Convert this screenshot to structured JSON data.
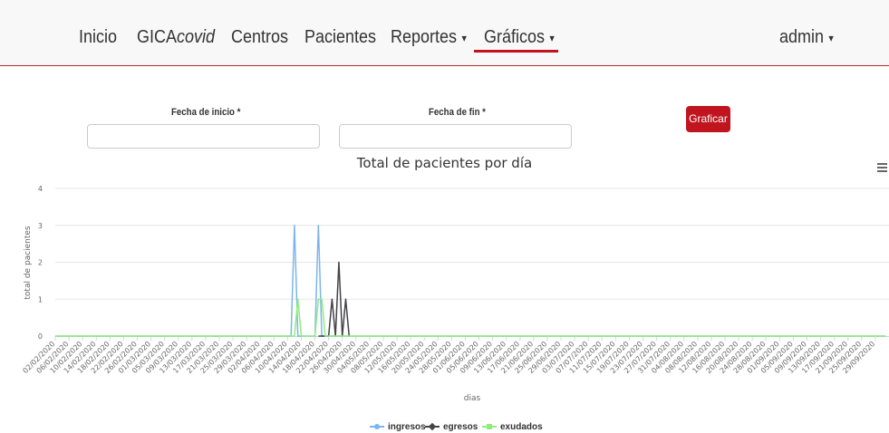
{
  "nav": {
    "inicio": "Inicio",
    "brand_prefix": "GICA",
    "brand_suffix": "covid",
    "centros": "Centros",
    "pacientes": "Pacientes",
    "reportes": "Reportes",
    "graficos": "Gráficos",
    "admin": "admin",
    "caret": "▾",
    "accent_color": "#c0141f"
  },
  "form": {
    "start_label": "Fecha de inicio *",
    "start_value": "",
    "end_label": "Fecha de fin *",
    "end_value": "",
    "submit_label": "Graficar"
  },
  "chart_menu_icon": "hamburger-menu-icon",
  "chart_data": {
    "type": "line",
    "title": "Total de pacientes por día",
    "xlabel": "dias",
    "ylabel": "total de pacientes",
    "ylim": [
      0,
      4
    ],
    "yticks": [
      0,
      1,
      2,
      3,
      4
    ],
    "grid": true,
    "legend_position": "bottom",
    "x": [
      "02/02/2020",
      "03/02/2020",
      "04/02/2020",
      "05/02/2020",
      "06/02/2020",
      "07/02/2020",
      "08/02/2020",
      "09/02/2020",
      "10/02/2020",
      "11/02/2020",
      "12/02/2020",
      "13/02/2020",
      "14/02/2020",
      "15/02/2020",
      "16/02/2020",
      "17/02/2020",
      "18/02/2020",
      "19/02/2020",
      "20/02/2020",
      "21/02/2020",
      "22/02/2020",
      "23/02/2020",
      "24/02/2020",
      "25/02/2020",
      "26/02/2020",
      "27/02/2020",
      "28/02/2020",
      "29/02/2020",
      "01/03/2020",
      "02/03/2020",
      "03/03/2020",
      "04/03/2020",
      "05/03/2020",
      "06/03/2020",
      "07/03/2020",
      "08/03/2020",
      "09/03/2020",
      "10/03/2020",
      "11/03/2020",
      "12/03/2020",
      "13/03/2020",
      "14/03/2020",
      "15/03/2020",
      "16/03/2020",
      "17/03/2020",
      "18/03/2020",
      "19/03/2020",
      "20/03/2020",
      "21/03/2020",
      "22/03/2020",
      "23/03/2020",
      "24/03/2020",
      "25/03/2020",
      "26/03/2020",
      "27/03/2020",
      "28/03/2020",
      "29/03/2020",
      "30/03/2020",
      "31/03/2020",
      "01/04/2020",
      "02/04/2020",
      "03/04/2020",
      "04/04/2020",
      "05/04/2020",
      "06/04/2020",
      "07/04/2020",
      "08/04/2020",
      "09/04/2020",
      "10/04/2020",
      "11/04/2020",
      "12/04/2020",
      "13/04/2020",
      "14/04/2020",
      "15/04/2020",
      "16/04/2020",
      "17/04/2020",
      "18/04/2020",
      "19/04/2020",
      "20/04/2020",
      "21/04/2020",
      "22/04/2020",
      "23/04/2020",
      "24/04/2020",
      "25/04/2020",
      "26/04/2020",
      "27/04/2020",
      "28/04/2020",
      "29/04/2020",
      "30/04/2020",
      "01/05/2020",
      "02/05/2020",
      "03/05/2020",
      "04/05/2020",
      "05/05/2020",
      "06/05/2020",
      "07/05/2020",
      "08/05/2020",
      "09/05/2020",
      "10/05/2020",
      "11/05/2020",
      "12/05/2020",
      "13/05/2020",
      "14/05/2020",
      "15/05/2020",
      "16/05/2020",
      "17/05/2020",
      "18/05/2020",
      "19/05/2020",
      "20/05/2020",
      "21/05/2020",
      "22/05/2020",
      "23/05/2020",
      "24/05/2020",
      "25/05/2020",
      "26/05/2020",
      "27/05/2020",
      "28/05/2020",
      "29/05/2020",
      "30/05/2020",
      "31/05/2020",
      "01/06/2020",
      "02/06/2020",
      "03/06/2020",
      "04/06/2020",
      "05/06/2020",
      "06/06/2020",
      "07/06/2020",
      "08/06/2020",
      "09/06/2020",
      "10/06/2020",
      "11/06/2020",
      "12/06/2020",
      "13/06/2020",
      "14/06/2020",
      "15/06/2020",
      "16/06/2020",
      "17/06/2020",
      "18/06/2020",
      "19/06/2020",
      "20/06/2020",
      "21/06/2020",
      "22/06/2020",
      "23/06/2020",
      "24/06/2020",
      "25/06/2020",
      "26/06/2020",
      "27/06/2020",
      "28/06/2020",
      "29/06/2020",
      "30/06/2020",
      "01/07/2020",
      "02/07/2020",
      "03/07/2020",
      "04/07/2020",
      "05/07/2020",
      "06/07/2020",
      "07/07/2020",
      "08/07/2020",
      "09/07/2020",
      "10/07/2020",
      "11/07/2020",
      "12/07/2020",
      "13/07/2020",
      "14/07/2020",
      "15/07/2020",
      "16/07/2020",
      "17/07/2020",
      "18/07/2020",
      "19/07/2020",
      "20/07/2020",
      "21/07/2020",
      "22/07/2020",
      "23/07/2020",
      "24/07/2020",
      "25/07/2020",
      "26/07/2020",
      "27/07/2020",
      "28/07/2020",
      "29/07/2020",
      "30/07/2020",
      "31/07/2020",
      "01/08/2020",
      "02/08/2020",
      "03/08/2020",
      "04/08/2020",
      "05/08/2020",
      "06/08/2020",
      "07/08/2020",
      "08/08/2020",
      "09/08/2020",
      "10/08/2020",
      "11/08/2020",
      "12/08/2020",
      "13/08/2020",
      "14/08/2020",
      "15/08/2020",
      "16/08/2020",
      "17/08/2020",
      "18/08/2020",
      "19/08/2020",
      "20/08/2020",
      "21/08/2020",
      "22/08/2020",
      "23/08/2020",
      "24/08/2020",
      "25/08/2020",
      "26/08/2020",
      "27/08/2020",
      "28/08/2020",
      "29/08/2020",
      "30/08/2020",
      "31/08/2020",
      "01/09/2020",
      "02/09/2020",
      "03/09/2020",
      "04/09/2020",
      "05/09/2020",
      "06/09/2020",
      "07/09/2020",
      "08/09/2020",
      "09/09/2020",
      "10/09/2020",
      "11/09/2020",
      "12/09/2020",
      "13/09/2020",
      "14/09/2020",
      "15/09/2020",
      "16/09/2020",
      "17/09/2020",
      "18/09/2020",
      "19/09/2020",
      "20/09/2020",
      "21/09/2020",
      "22/09/2020",
      "23/09/2020",
      "24/09/2020",
      "25/09/2020",
      "26/09/2020",
      "27/09/2020",
      "28/09/2020",
      "29/09/2020",
      "30/09/2020",
      "01/10/2020",
      "02/10/2020",
      "03/10/2020"
    ],
    "xtick_labels": [
      "02/02/2020",
      "06/02/2020",
      "10/02/2020",
      "14/02/2020",
      "18/02/2020",
      "22/02/2020",
      "26/02/2020",
      "01/03/2020",
      "05/03/2020",
      "09/03/2020",
      "13/03/2020",
      "17/03/2020",
      "21/03/2020",
      "25/03/2020",
      "29/03/2020",
      "02/04/2020",
      "06/04/2020",
      "10/04/2020",
      "14/04/2020",
      "18/04/2020",
      "22/04/2020",
      "26/04/2020",
      "30/04/2020",
      "04/05/2020",
      "08/05/2020",
      "12/05/2020",
      "16/05/2020",
      "20/05/2020",
      "24/05/2020",
      "28/05/2020",
      "01/06/2020",
      "05/06/2020",
      "09/06/2020",
      "13/06/2020",
      "17/06/2020",
      "21/06/2020",
      "25/06/2020",
      "29/06/2020",
      "03/07/2020",
      "07/07/2020",
      "11/07/2020",
      "15/07/2020",
      "19/07/2020",
      "23/07/2020",
      "27/07/2020",
      "31/07/2020",
      "04/08/2020",
      "08/08/2020",
      "12/08/2020",
      "16/08/2020",
      "20/08/2020",
      "24/08/2020",
      "28/08/2020",
      "01/09/2020",
      "05/09/2020",
      "09/09/2020",
      "13/09/2020",
      "17/09/2020",
      "21/09/2020",
      "25/09/2020",
      "29/09/2020"
    ],
    "series": [
      {
        "name": "ingresos",
        "color": "#7cb5ec",
        "marker": "circle",
        "values": [
          0,
          0,
          0,
          0,
          0,
          0,
          0,
          0,
          0,
          0,
          0,
          0,
          0,
          0,
          0,
          0,
          0,
          0,
          0,
          0,
          0,
          0,
          0,
          0,
          0,
          0,
          0,
          0,
          0,
          0,
          0,
          0,
          0,
          0,
          0,
          0,
          0,
          0,
          0,
          0,
          0,
          0,
          0,
          0,
          0,
          0,
          0,
          0,
          0,
          0,
          0,
          0,
          0,
          0,
          0,
          0,
          0,
          0,
          0,
          0,
          0,
          0,
          0,
          0,
          0,
          0,
          0,
          0,
          0,
          0,
          3,
          0,
          0,
          0,
          0,
          0,
          0,
          3,
          0,
          0,
          0,
          0,
          0,
          0,
          0,
          0,
          0,
          0,
          0,
          0,
          0,
          0,
          0,
          0,
          0,
          0,
          0,
          0,
          0,
          0,
          0,
          0,
          0,
          0,
          0,
          0,
          0,
          0,
          0,
          0,
          0,
          0,
          0,
          0,
          0,
          0,
          0,
          0,
          0,
          0,
          0,
          0,
          0,
          0,
          0,
          0,
          0,
          0,
          0,
          0,
          0,
          0,
          0,
          0,
          0,
          0,
          0,
          0,
          0,
          0,
          0,
          0,
          0,
          0,
          0,
          0,
          0,
          0,
          0,
          0,
          0,
          0,
          0,
          0,
          0,
          0,
          0,
          0,
          0,
          0,
          0,
          0,
          0,
          0,
          0,
          0,
          0,
          0,
          0,
          0,
          0,
          0,
          0,
          0,
          0,
          0,
          0,
          0,
          0,
          0,
          0,
          0,
          0,
          0,
          0,
          0,
          0,
          0,
          0,
          0,
          0,
          0,
          0,
          0,
          0,
          0,
          0,
          0,
          0,
          0,
          0,
          0,
          0,
          0,
          0,
          0,
          0,
          0,
          0,
          0,
          0,
          0,
          0,
          0,
          0,
          0,
          0,
          0,
          0,
          0,
          0,
          0,
          0,
          0,
          0,
          0,
          0,
          0,
          0,
          0,
          0,
          0,
          0,
          0,
          0,
          0,
          0,
          0,
          0,
          0,
          0,
          0,
          0,
          0
        ]
      },
      {
        "name": "egresos",
        "color": "#434348",
        "marker": "diamond",
        "values": [
          null,
          null,
          null,
          null,
          null,
          null,
          null,
          null,
          null,
          null,
          null,
          null,
          null,
          null,
          null,
          null,
          null,
          null,
          null,
          null,
          null,
          null,
          null,
          null,
          null,
          null,
          null,
          null,
          null,
          null,
          null,
          null,
          null,
          null,
          null,
          null,
          null,
          null,
          null,
          null,
          null,
          null,
          null,
          null,
          null,
          null,
          null,
          null,
          null,
          null,
          null,
          null,
          null,
          null,
          null,
          null,
          null,
          null,
          null,
          null,
          null,
          null,
          null,
          null,
          null,
          null,
          null,
          null,
          null,
          null,
          null,
          null,
          null,
          null,
          null,
          null,
          null,
          0,
          0,
          0,
          0,
          1,
          0,
          2,
          0,
          1,
          0,
          null,
          null,
          null,
          null,
          null,
          null,
          null,
          null,
          null,
          null,
          null,
          null,
          null,
          null,
          null,
          null,
          null,
          null,
          null,
          null,
          null,
          null,
          null,
          null,
          null,
          null,
          null,
          null,
          null,
          null,
          null,
          null,
          null,
          null,
          null,
          null,
          null,
          null,
          null,
          null,
          null,
          null,
          null,
          null,
          null,
          null,
          null,
          null,
          null,
          null,
          null,
          null,
          null,
          null,
          null,
          null,
          null,
          null,
          null,
          null,
          null,
          null,
          null,
          null,
          null,
          null,
          null,
          null,
          null,
          null,
          null,
          null,
          null,
          null,
          null,
          null,
          null,
          null,
          null,
          null,
          null,
          null,
          null,
          null,
          null,
          null,
          null,
          null,
          null,
          null,
          null,
          null,
          null,
          null,
          null,
          null,
          null,
          null,
          null,
          null,
          null,
          null,
          null,
          null,
          null,
          null,
          null,
          null,
          null,
          null,
          null,
          null,
          null,
          null,
          null,
          null,
          null,
          null,
          null,
          null,
          null,
          null,
          null,
          null,
          null,
          null,
          null,
          null,
          null,
          null,
          null,
          null,
          null,
          null,
          null,
          null,
          null,
          null,
          null,
          null,
          null,
          null,
          null,
          null,
          null,
          null,
          null,
          null,
          null,
          null,
          null,
          null,
          null,
          null,
          null
        ]
      },
      {
        "name": "exudados",
        "color": "#90ed7d",
        "marker": "square",
        "values": [
          0,
          0,
          0,
          0,
          0,
          0,
          0,
          0,
          0,
          0,
          0,
          0,
          0,
          0,
          0,
          0,
          0,
          0,
          0,
          0,
          0,
          0,
          0,
          0,
          0,
          0,
          0,
          0,
          0,
          0,
          0,
          0,
          0,
          0,
          0,
          0,
          0,
          0,
          0,
          0,
          0,
          0,
          0,
          0,
          0,
          0,
          0,
          0,
          0,
          0,
          0,
          0,
          0,
          0,
          0,
          0,
          0,
          0,
          0,
          0,
          0,
          0,
          0,
          0,
          0,
          0,
          0,
          0,
          0,
          0,
          0,
          1,
          0,
          0,
          0,
          0,
          0,
          1,
          1,
          0,
          0,
          0,
          0,
          0,
          0,
          0,
          0,
          0,
          0,
          0,
          0,
          0,
          0,
          0,
          0,
          0,
          0,
          0,
          0,
          0,
          0,
          0,
          0,
          0,
          0,
          0,
          0,
          0,
          0,
          0,
          0,
          0,
          0,
          0,
          0,
          0,
          0,
          0,
          0,
          0,
          0,
          0,
          0,
          0,
          0,
          0,
          0,
          0,
          0,
          0,
          0,
          0,
          0,
          0,
          0,
          0,
          0,
          0,
          0,
          0,
          0,
          0,
          0,
          0,
          0,
          0,
          0,
          0,
          0,
          0,
          0,
          0,
          0,
          0,
          0,
          0,
          0,
          0,
          0,
          0,
          0,
          0,
          0,
          0,
          0,
          0,
          0,
          0,
          0,
          0,
          0,
          0,
          0,
          0,
          0,
          0,
          0,
          0,
          0,
          0,
          0,
          0,
          0,
          0,
          0,
          0,
          0,
          0,
          0,
          0,
          0,
          0,
          0,
          0,
          0,
          0,
          0,
          0,
          0,
          0,
          0,
          0,
          0,
          0,
          0,
          0,
          0,
          0,
          0,
          0,
          0,
          0,
          0,
          0,
          0,
          0,
          0,
          0,
          0,
          0,
          0,
          0,
          0,
          0,
          0,
          0,
          0,
          0,
          0,
          0,
          0,
          0,
          0,
          0,
          0,
          0,
          0,
          0,
          0,
          0,
          0,
          0,
          0,
          0
        ]
      }
    ]
  }
}
